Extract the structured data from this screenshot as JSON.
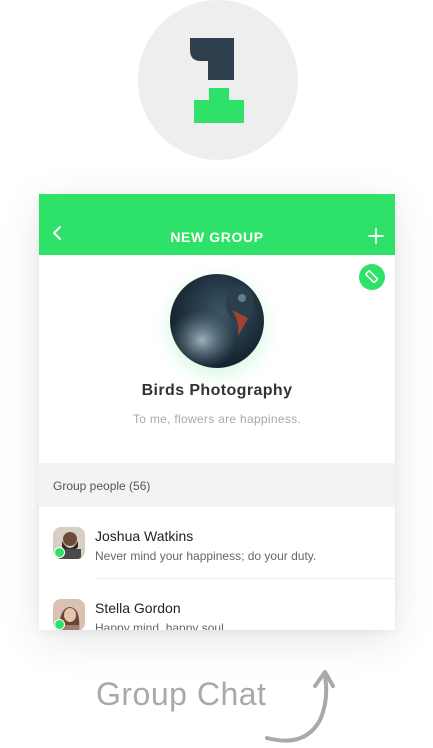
{
  "step": {
    "number": "1"
  },
  "header": {
    "title": "NEW GROUP"
  },
  "group": {
    "name": "Birds Photography",
    "description": "To me, flowers are happiness."
  },
  "members_section": {
    "label": "Group people (56)"
  },
  "members": [
    {
      "name": "Joshua Watkins",
      "status": "Never mind your happiness; do your duty.",
      "online": true
    },
    {
      "name": "Stella Gordon",
      "status": "Happy mind, happy soul",
      "online": true
    }
  ],
  "caption": "Group Chat",
  "colors": {
    "accent": "#2ee168",
    "step_dark": "#2f3e4d",
    "caption": "#a9a9a9"
  },
  "icons": [
    "back-chevron-icon",
    "plus-icon",
    "pencil-icon",
    "curved-arrow-up-icon"
  ]
}
